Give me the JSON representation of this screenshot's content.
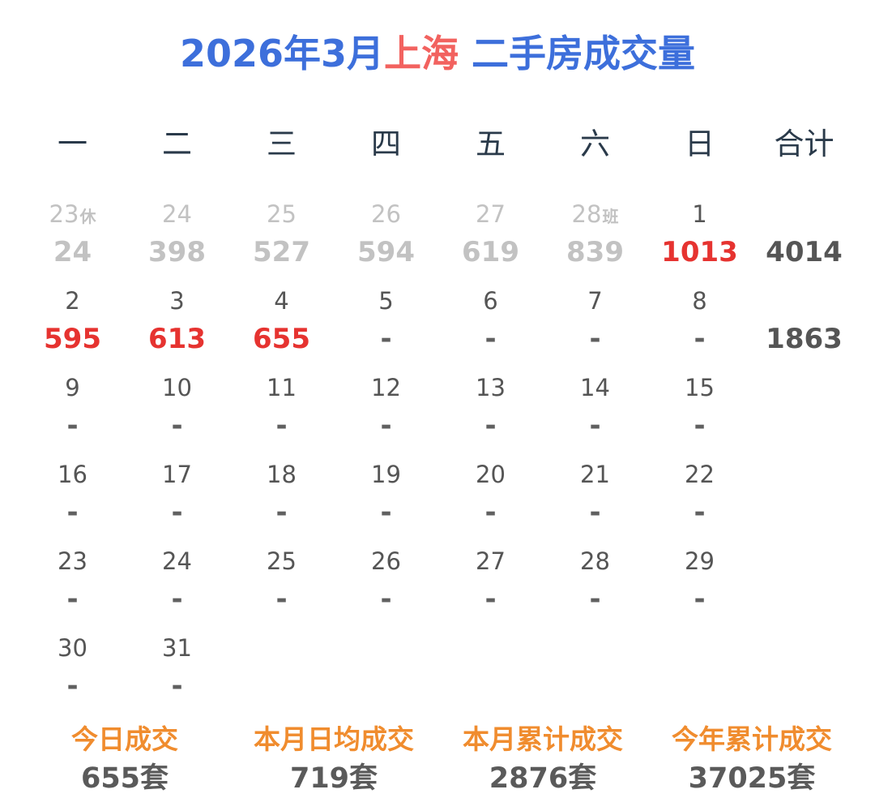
{
  "title": {
    "prefix": "2026年3月",
    "city": "上海",
    "suffix": " 二手房成交量"
  },
  "weekdays": [
    "一",
    "二",
    "三",
    "四",
    "五",
    "六",
    "日",
    "合计"
  ],
  "colors": {
    "title": "#3d6fdb",
    "city": "#f2625f",
    "highlight": "#e63330",
    "muted": "#c2c2c2",
    "stat_label": "#f08c2e"
  },
  "weeks": [
    {
      "days": [
        {
          "day": "23",
          "suffix": "休",
          "value": "24",
          "state": "prev"
        },
        {
          "day": "24",
          "suffix": "",
          "value": "398",
          "state": "prev"
        },
        {
          "day": "25",
          "suffix": "",
          "value": "527",
          "state": "prev"
        },
        {
          "day": "26",
          "suffix": "",
          "value": "594",
          "state": "prev"
        },
        {
          "day": "27",
          "suffix": "",
          "value": "619",
          "state": "prev"
        },
        {
          "day": "28",
          "suffix": "班",
          "value": "839",
          "state": "prev"
        },
        {
          "day": "1",
          "suffix": "",
          "value": "1013",
          "state": "hl"
        }
      ],
      "total": "4014"
    },
    {
      "days": [
        {
          "day": "2",
          "suffix": "",
          "value": "595",
          "state": "hl"
        },
        {
          "day": "3",
          "suffix": "",
          "value": "613",
          "state": "hl"
        },
        {
          "day": "4",
          "suffix": "",
          "value": "655",
          "state": "hl"
        },
        {
          "day": "5",
          "suffix": "",
          "value": "-",
          "state": "empty"
        },
        {
          "day": "6",
          "suffix": "",
          "value": "-",
          "state": "empty"
        },
        {
          "day": "7",
          "suffix": "",
          "value": "-",
          "state": "empty"
        },
        {
          "day": "8",
          "suffix": "",
          "value": "-",
          "state": "empty"
        }
      ],
      "total": "1863"
    },
    {
      "days": [
        {
          "day": "9",
          "suffix": "",
          "value": "-",
          "state": "empty"
        },
        {
          "day": "10",
          "suffix": "",
          "value": "-",
          "state": "empty"
        },
        {
          "day": "11",
          "suffix": "",
          "value": "-",
          "state": "empty"
        },
        {
          "day": "12",
          "suffix": "",
          "value": "-",
          "state": "empty"
        },
        {
          "day": "13",
          "suffix": "",
          "value": "-",
          "state": "empty"
        },
        {
          "day": "14",
          "suffix": "",
          "value": "-",
          "state": "empty"
        },
        {
          "day": "15",
          "suffix": "",
          "value": "-",
          "state": "empty"
        }
      ],
      "total": ""
    },
    {
      "days": [
        {
          "day": "16",
          "suffix": "",
          "value": "-",
          "state": "empty"
        },
        {
          "day": "17",
          "suffix": "",
          "value": "-",
          "state": "empty"
        },
        {
          "day": "18",
          "suffix": "",
          "value": "-",
          "state": "empty"
        },
        {
          "day": "19",
          "suffix": "",
          "value": "-",
          "state": "empty"
        },
        {
          "day": "20",
          "suffix": "",
          "value": "-",
          "state": "empty"
        },
        {
          "day": "21",
          "suffix": "",
          "value": "-",
          "state": "empty"
        },
        {
          "day": "22",
          "suffix": "",
          "value": "-",
          "state": "empty"
        }
      ],
      "total": ""
    },
    {
      "days": [
        {
          "day": "23",
          "suffix": "",
          "value": "-",
          "state": "empty"
        },
        {
          "day": "24",
          "suffix": "",
          "value": "-",
          "state": "empty"
        },
        {
          "day": "25",
          "suffix": "",
          "value": "-",
          "state": "empty"
        },
        {
          "day": "26",
          "suffix": "",
          "value": "-",
          "state": "empty"
        },
        {
          "day": "27",
          "suffix": "",
          "value": "-",
          "state": "empty"
        },
        {
          "day": "28",
          "suffix": "",
          "value": "-",
          "state": "empty"
        },
        {
          "day": "29",
          "suffix": "",
          "value": "-",
          "state": "empty"
        }
      ],
      "total": ""
    },
    {
      "days": [
        {
          "day": "30",
          "suffix": "",
          "value": "-",
          "state": "empty"
        },
        {
          "day": "31",
          "suffix": "",
          "value": "-",
          "state": "empty"
        }
      ],
      "total": ""
    }
  ],
  "stats": [
    {
      "label": "今日成交",
      "value": "655套"
    },
    {
      "label": "本月日均成交",
      "value": "719套"
    },
    {
      "label": "本月累计成交",
      "value": "2876套"
    },
    {
      "label": "今年累计成交",
      "value": "37025套"
    }
  ]
}
